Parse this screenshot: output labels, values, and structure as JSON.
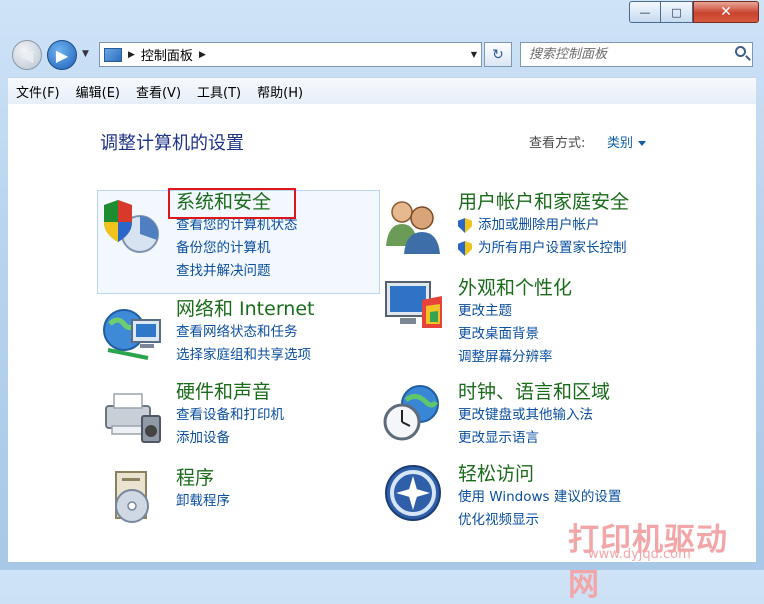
{
  "window": {
    "min": "—",
    "max": "□",
    "close": "✕"
  },
  "nav": {
    "back": "◀",
    "forward": "▶",
    "history": "▼"
  },
  "address": {
    "crumb": "控制面板",
    "sep1": "▶",
    "sep2": "▶",
    "dropdown": "▼",
    "refresh": "↻"
  },
  "search": {
    "placeholder": "搜索控制面板"
  },
  "menu": [
    "文件(F)",
    "编辑(E)",
    "查看(V)",
    "工具(T)",
    "帮助(H)"
  ],
  "page": {
    "title": "调整计算机的设置",
    "view_label": "查看方式:",
    "view_value": "类别"
  },
  "categories": {
    "system": {
      "title": "系统和安全",
      "links": [
        "查看您的计算机状态",
        "备份您的计算机",
        "查找并解决问题"
      ]
    },
    "network": {
      "title": "网络和 Internet",
      "links": [
        "查看网络状态和任务",
        "选择家庭组和共享选项"
      ]
    },
    "hardware": {
      "title": "硬件和声音",
      "links": [
        "查看设备和打印机",
        "添加设备"
      ]
    },
    "programs": {
      "title": "程序",
      "links": [
        "卸载程序"
      ]
    },
    "users": {
      "title": "用户帐户和家庭安全",
      "links": [
        "添加或删除用户帐户",
        "为所有用户设置家长控制"
      ]
    },
    "appearance": {
      "title": "外观和个性化",
      "links": [
        "更改主题",
        "更改桌面背景",
        "调整屏幕分辨率"
      ]
    },
    "clock": {
      "title": "时钟、语言和区域",
      "links": [
        "更改键盘或其他输入法",
        "更改显示语言"
      ]
    },
    "ease": {
      "title": "轻松访问",
      "links": [
        "使用 Windows 建议的设置",
        "优化视频显示"
      ]
    }
  },
  "watermark": {
    "text": "打印机驱动网",
    "url": "www.dyjqd.com"
  }
}
